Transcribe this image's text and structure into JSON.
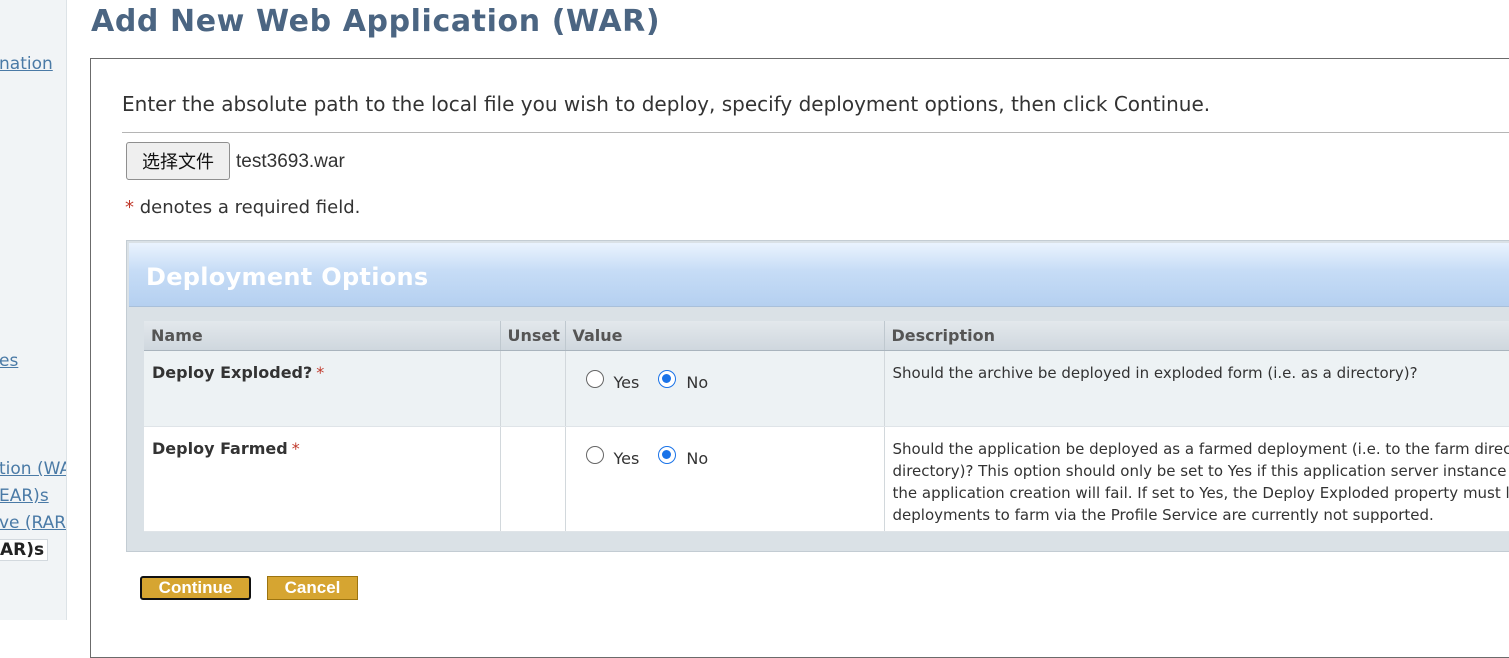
{
  "sidebar": {
    "links": [
      {
        "label": "nation"
      },
      {
        "label": "es"
      },
      {
        "label": "tion (WA"
      },
      {
        "label": "EAR)s"
      },
      {
        "label": "ve (RAR"
      },
      {
        "label": "AR)s"
      }
    ]
  },
  "page": {
    "title": "Add New Web Application (WAR)",
    "instruction": "Enter the absolute path to the local file you wish to deploy, specify deployment options, then click Continue."
  },
  "file_input": {
    "button_label": "选择文件",
    "file_name": "test3693.war"
  },
  "required_note": {
    "marker": "*",
    "text": "denotes a required field."
  },
  "options": {
    "title": "Deployment Options",
    "columns": [
      "Name",
      "Unset",
      "Value",
      "Description"
    ],
    "rows": [
      {
        "name": "Deploy Exploded?",
        "required_marker": "*",
        "yes_label": "Yes",
        "no_label": "No",
        "selected": "No",
        "description": "Should the archive be deployed in exploded form (i.e. as a directory)?"
      },
      {
        "name": "Deploy Farmed",
        "required_marker": "*",
        "yes_label": "Yes",
        "no_label": "No",
        "selected": "No",
        "description": "Should the application be deployed as a farmed deployment (i.e. to the farm direc\ndirectory)? This option should only be set to Yes if this application server instance\nthe application creation will fail. If set to Yes, the Deploy Exploded property must l\ndeployments to farm via the Profile Service are currently not supported."
      }
    ]
  },
  "actions": {
    "continue_label": "Continue",
    "cancel_label": "Cancel"
  },
  "colors": {
    "title": "#4b6582",
    "link": "#4a7aa6",
    "required_star": "#c0392b",
    "button": "#d6a531",
    "radio_checked": "#1a73e8"
  }
}
